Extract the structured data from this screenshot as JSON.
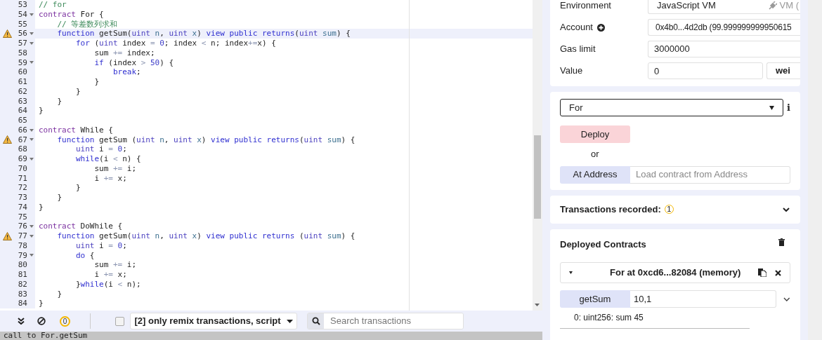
{
  "editor": {
    "lines": [
      {
        "num": "53",
        "fold": false,
        "warning": false,
        "active": false,
        "tokens": [
          {
            "kind": "comment",
            "text": "// for"
          }
        ]
      },
      {
        "num": "54",
        "fold": true,
        "warning": false,
        "active": false,
        "tokens": [
          {
            "kind": "contract",
            "text": "contract"
          },
          {
            "kind": "plain",
            "text": " For {"
          }
        ]
      },
      {
        "num": "55",
        "fold": false,
        "warning": false,
        "active": false,
        "tokens": [
          {
            "kind": "comment",
            "text": "    // 等差数列求和"
          }
        ]
      },
      {
        "num": "56",
        "fold": true,
        "warning": true,
        "active": true,
        "tokens": [
          {
            "kind": "keyword",
            "text": "    function"
          },
          {
            "kind": "plain",
            "text": " getSum("
          },
          {
            "kind": "type",
            "text": "uint"
          },
          {
            "kind": "param",
            "text": " n"
          },
          {
            "kind": "plain",
            "text": ", "
          },
          {
            "kind": "type",
            "text": "uint"
          },
          {
            "kind": "param",
            "text": " x"
          },
          {
            "kind": "plain",
            "text": ") "
          },
          {
            "kind": "keyword",
            "text": "view public returns"
          },
          {
            "kind": "plain",
            "text": "("
          },
          {
            "kind": "type",
            "text": "uint"
          },
          {
            "kind": "param",
            "text": " sum"
          },
          {
            "kind": "plain",
            "text": ") {"
          }
        ]
      },
      {
        "num": "57",
        "fold": true,
        "warning": false,
        "active": false,
        "tokens": [
          {
            "kind": "keyword",
            "text": "        for"
          },
          {
            "kind": "plain",
            "text": " ("
          },
          {
            "kind": "type",
            "text": "uint"
          },
          {
            "kind": "plain",
            "text": " index "
          },
          {
            "kind": "op",
            "text": "="
          },
          {
            "kind": "number",
            "text": " 0"
          },
          {
            "kind": "plain",
            "text": "; index "
          },
          {
            "kind": "op",
            "text": "<"
          },
          {
            "kind": "plain",
            "text": " n; index"
          },
          {
            "kind": "op",
            "text": "+="
          },
          {
            "kind": "plain",
            "text": "x) {"
          }
        ]
      },
      {
        "num": "58",
        "fold": false,
        "warning": false,
        "active": false,
        "tokens": [
          {
            "kind": "plain",
            "text": "            sum "
          },
          {
            "kind": "op",
            "text": "+="
          },
          {
            "kind": "plain",
            "text": " index;"
          }
        ]
      },
      {
        "num": "59",
        "fold": true,
        "warning": false,
        "active": false,
        "tokens": [
          {
            "kind": "keyword",
            "text": "            if"
          },
          {
            "kind": "plain",
            "text": " (index "
          },
          {
            "kind": "op",
            "text": ">"
          },
          {
            "kind": "number",
            "text": " 50"
          },
          {
            "kind": "plain",
            "text": ") {"
          }
        ]
      },
      {
        "num": "60",
        "fold": false,
        "warning": false,
        "active": false,
        "tokens": [
          {
            "kind": "keyword",
            "text": "                break"
          },
          {
            "kind": "plain",
            "text": ";"
          }
        ]
      },
      {
        "num": "61",
        "fold": false,
        "warning": false,
        "active": false,
        "tokens": [
          {
            "kind": "plain",
            "text": "            }"
          }
        ]
      },
      {
        "num": "62",
        "fold": false,
        "warning": false,
        "active": false,
        "tokens": [
          {
            "kind": "plain",
            "text": "        }"
          }
        ]
      },
      {
        "num": "63",
        "fold": false,
        "warning": false,
        "active": false,
        "tokens": [
          {
            "kind": "plain",
            "text": "    }"
          }
        ]
      },
      {
        "num": "64",
        "fold": false,
        "warning": false,
        "active": false,
        "tokens": [
          {
            "kind": "plain",
            "text": "}"
          }
        ]
      },
      {
        "num": "65",
        "fold": false,
        "warning": false,
        "active": false
      },
      {
        "num": "66",
        "fold": true,
        "warning": false,
        "active": false,
        "tokens": [
          {
            "kind": "contract",
            "text": "contract"
          },
          {
            "kind": "plain",
            "text": " While {"
          }
        ]
      },
      {
        "num": "67",
        "fold": true,
        "warning": true,
        "active": false,
        "tokens": [
          {
            "kind": "keyword",
            "text": "    function"
          },
          {
            "kind": "plain",
            "text": " getSum ("
          },
          {
            "kind": "type",
            "text": "uint"
          },
          {
            "kind": "param",
            "text": " n"
          },
          {
            "kind": "plain",
            "text": ", "
          },
          {
            "kind": "type",
            "text": "uint"
          },
          {
            "kind": "param",
            "text": " x"
          },
          {
            "kind": "plain",
            "text": ") "
          },
          {
            "kind": "keyword",
            "text": "view public returns"
          },
          {
            "kind": "plain",
            "text": "("
          },
          {
            "kind": "type",
            "text": "uint"
          },
          {
            "kind": "param",
            "text": " sum"
          },
          {
            "kind": "plain",
            "text": ") {"
          }
        ]
      },
      {
        "num": "68",
        "fold": false,
        "warning": false,
        "active": false,
        "tokens": [
          {
            "kind": "type",
            "text": "        uint"
          },
          {
            "kind": "plain",
            "text": " i "
          },
          {
            "kind": "op",
            "text": "="
          },
          {
            "kind": "number",
            "text": " 0"
          },
          {
            "kind": "plain",
            "text": ";"
          }
        ]
      },
      {
        "num": "69",
        "fold": true,
        "warning": false,
        "active": false,
        "tokens": [
          {
            "kind": "keyword",
            "text": "        while"
          },
          {
            "kind": "plain",
            "text": "(i "
          },
          {
            "kind": "op",
            "text": "<"
          },
          {
            "kind": "plain",
            "text": " n) {"
          }
        ]
      },
      {
        "num": "70",
        "fold": false,
        "warning": false,
        "active": false,
        "tokens": [
          {
            "kind": "plain",
            "text": "            sum "
          },
          {
            "kind": "op",
            "text": "+="
          },
          {
            "kind": "plain",
            "text": " i;"
          }
        ]
      },
      {
        "num": "71",
        "fold": false,
        "warning": false,
        "active": false,
        "tokens": [
          {
            "kind": "plain",
            "text": "            i "
          },
          {
            "kind": "op",
            "text": "+="
          },
          {
            "kind": "plain",
            "text": " x;"
          }
        ]
      },
      {
        "num": "72",
        "fold": false,
        "warning": false,
        "active": false,
        "tokens": [
          {
            "kind": "plain",
            "text": "        }"
          }
        ]
      },
      {
        "num": "73",
        "fold": false,
        "warning": false,
        "active": false,
        "tokens": [
          {
            "kind": "plain",
            "text": "    }"
          }
        ]
      },
      {
        "num": "74",
        "fold": false,
        "warning": false,
        "active": false,
        "tokens": [
          {
            "kind": "plain",
            "text": "}"
          }
        ]
      },
      {
        "num": "75",
        "fold": false,
        "warning": false,
        "active": false
      },
      {
        "num": "76",
        "fold": true,
        "warning": false,
        "active": false,
        "tokens": [
          {
            "kind": "contract",
            "text": "contract"
          },
          {
            "kind": "plain",
            "text": " DoWhile {"
          }
        ]
      },
      {
        "num": "77",
        "fold": true,
        "warning": true,
        "active": false,
        "tokens": [
          {
            "kind": "keyword",
            "text": "    function"
          },
          {
            "kind": "plain",
            "text": " getSum("
          },
          {
            "kind": "type",
            "text": "uint"
          },
          {
            "kind": "param",
            "text": " n"
          },
          {
            "kind": "plain",
            "text": ", "
          },
          {
            "kind": "type",
            "text": "uint"
          },
          {
            "kind": "param",
            "text": " x"
          },
          {
            "kind": "plain",
            "text": ") "
          },
          {
            "kind": "keyword",
            "text": "view public returns"
          },
          {
            "kind": "plain",
            "text": " ("
          },
          {
            "kind": "type",
            "text": "uint"
          },
          {
            "kind": "param",
            "text": " sum"
          },
          {
            "kind": "plain",
            "text": ") {"
          }
        ]
      },
      {
        "num": "78",
        "fold": false,
        "warning": false,
        "active": false,
        "tokens": [
          {
            "kind": "type",
            "text": "        uint"
          },
          {
            "kind": "plain",
            "text": " i "
          },
          {
            "kind": "op",
            "text": "="
          },
          {
            "kind": "number",
            "text": " 0"
          },
          {
            "kind": "plain",
            "text": ";"
          }
        ]
      },
      {
        "num": "79",
        "fold": true,
        "warning": false,
        "active": false,
        "tokens": [
          {
            "kind": "keyword",
            "text": "        do"
          },
          {
            "kind": "plain",
            "text": " {"
          }
        ]
      },
      {
        "num": "80",
        "fold": false,
        "warning": false,
        "active": false,
        "tokens": [
          {
            "kind": "plain",
            "text": "            sum "
          },
          {
            "kind": "op",
            "text": "+="
          },
          {
            "kind": "plain",
            "text": " i;"
          }
        ]
      },
      {
        "num": "81",
        "fold": false,
        "warning": false,
        "active": false,
        "tokens": [
          {
            "kind": "plain",
            "text": "            i "
          },
          {
            "kind": "op",
            "text": "+="
          },
          {
            "kind": "plain",
            "text": " x;"
          }
        ]
      },
      {
        "num": "82",
        "fold": false,
        "warning": false,
        "active": false,
        "tokens": [
          {
            "kind": "plain",
            "text": "        }"
          },
          {
            "kind": "keyword",
            "text": "while"
          },
          {
            "kind": "plain",
            "text": "(i "
          },
          {
            "kind": "op",
            "text": "<"
          },
          {
            "kind": "plain",
            "text": " n);"
          }
        ]
      },
      {
        "num": "83",
        "fold": false,
        "warning": false,
        "active": false,
        "tokens": [
          {
            "kind": "plain",
            "text": "    }"
          }
        ]
      },
      {
        "num": "84",
        "fold": false,
        "warning": false,
        "active": false,
        "tokens": [
          {
            "kind": "plain",
            "text": "}"
          }
        ]
      }
    ]
  },
  "terminal": {
    "pending_count": "0",
    "listen_checked": false,
    "filter": "[2] only remix transactions, script",
    "search_placeholder": "Search transactions",
    "log_line": "call to For.getSum"
  },
  "run": {
    "environment": {
      "label": "Environment",
      "value": "JavaScript VM",
      "provider": "VM ("
    },
    "account": {
      "label": "Account",
      "value": "0x4b0...4d2db (99.999999999950615"
    },
    "gas_limit": {
      "label": "Gas limit",
      "value": "3000000"
    },
    "value": {
      "label": "Value",
      "value": "0",
      "unit": "wei"
    },
    "contract_select": "For",
    "info": "i",
    "deploy": "Deploy",
    "or": "or",
    "at_address": "At Address",
    "at_address_placeholder": "Load contract from Address",
    "transactions_recorded": "Transactions recorded:",
    "transactions_count": "1",
    "deployed_title": "Deployed Contracts",
    "instance": {
      "title": "For at 0xcd6...82084 (memory)",
      "expanded": true,
      "function": {
        "name": "getSum",
        "args": "10,1"
      },
      "result": "0: uint256: sum 45"
    }
  }
}
